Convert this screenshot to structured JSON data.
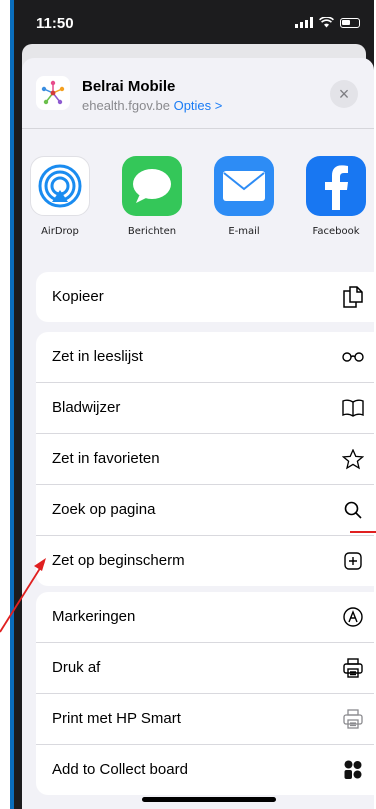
{
  "status": {
    "time": "11:50"
  },
  "header": {
    "app_name": "Belrai Mobile",
    "domain": "ehealth.fgov.be",
    "options_label": "Opties >",
    "close_symbol": "×"
  },
  "share_apps": [
    {
      "label": "AirDrop",
      "icon": "airdrop-icon",
      "color": "#1a8cf0"
    },
    {
      "label": "Berichten",
      "icon": "messages-icon",
      "color": "#34c759"
    },
    {
      "label": "E-mail",
      "icon": "mail-icon",
      "color": "#2d8cf5"
    },
    {
      "label": "Facebook",
      "icon": "facebook-icon",
      "color": "#1877f2"
    }
  ],
  "group1": [
    {
      "label": "Kopieer",
      "icon": "copy-icon"
    }
  ],
  "group2": [
    {
      "label": "Zet in leeslijst",
      "icon": "glasses-icon"
    },
    {
      "label": "Bladwijzer",
      "icon": "book-icon"
    },
    {
      "label": "Zet in favorieten",
      "icon": "star-icon"
    },
    {
      "label": "Zoek op pagina",
      "icon": "search-icon"
    },
    {
      "label": "Zet op beginscherm",
      "icon": "add-square-icon"
    }
  ],
  "group3": [
    {
      "label": "Markeringen",
      "icon": "markup-icon"
    },
    {
      "label": "Druk af",
      "icon": "print-icon"
    },
    {
      "label": "Print met HP Smart",
      "icon": "hp-print-icon"
    },
    {
      "label": "Add to Collect board",
      "icon": "collect-icon"
    }
  ],
  "colors": {
    "accent": "#1a7cf5",
    "annotation": "#e02020"
  }
}
